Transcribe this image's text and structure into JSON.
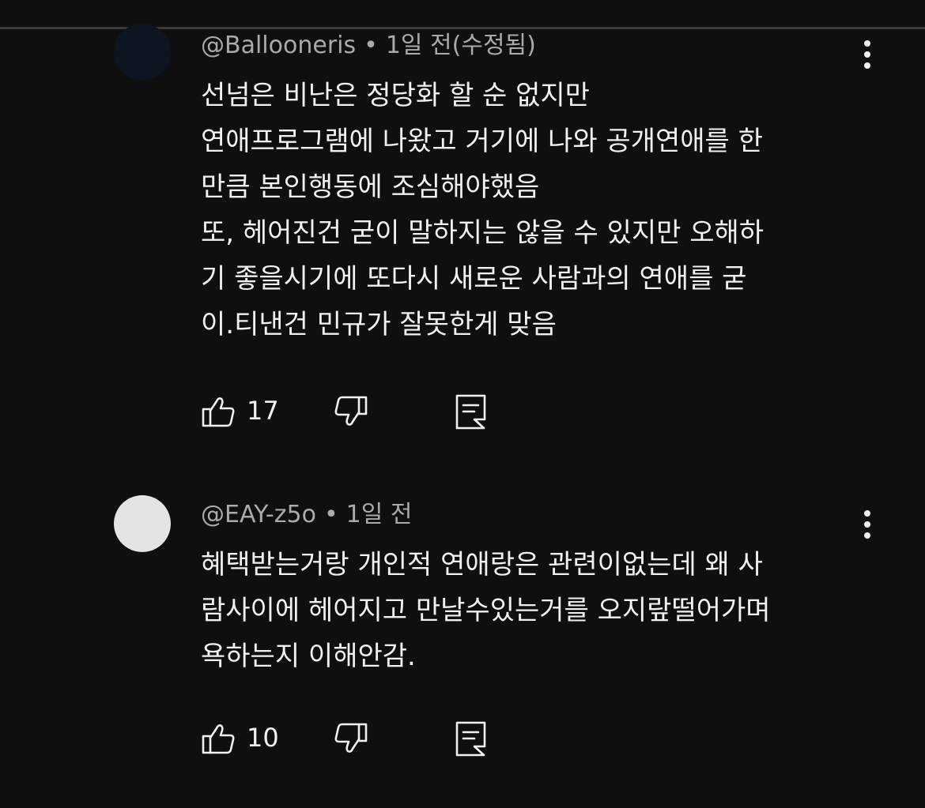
{
  "comments": [
    {
      "handle": "@Ballooneris",
      "separator": "•",
      "time": "1일 전(수정됨)",
      "avatar_color": "#0c1520",
      "text_lines": [
        "선넘은 비난은 정당화 할 순 없지만",
        "연애프로그램에 나왔고 거기에 나와 공개연애를 한",
        "만큼 본인행동에 조심해야했음",
        "또, 헤어진건 굳이 말하지는 않을 수 있지만 오해하",
        "기 좋을시기에 또다시 새로운 사람과의 연애를 굳",
        "이.티낸건 민규가 잘못한게 맞음"
      ],
      "like_count": "17",
      "icons": {
        "like": "thumbs-up-icon",
        "dislike": "thumbs-down-icon",
        "reply": "reply-icon",
        "more": "more-vertical-icon"
      }
    },
    {
      "handle": "@EAY-z5o",
      "separator": "•",
      "time": "1일 전",
      "avatar_color": "#e4e4e4",
      "text_lines": [
        "혜택받는거랑 개인적 연애랑은 관련이없는데 왜 사",
        "람사이에 헤어지고 만날수있는거를 오지랖떨어가며",
        "욕하는지 이해안감."
      ],
      "like_count": "10",
      "icons": {
        "like": "thumbs-up-icon",
        "dislike": "thumbs-down-icon",
        "reply": "reply-icon",
        "more": "more-vertical-icon"
      }
    }
  ],
  "colors": {
    "background": "#0f0f0f",
    "text": "#f1f1f1",
    "meta_text": "#aaaaaa",
    "divider": "#3a3a3a"
  }
}
